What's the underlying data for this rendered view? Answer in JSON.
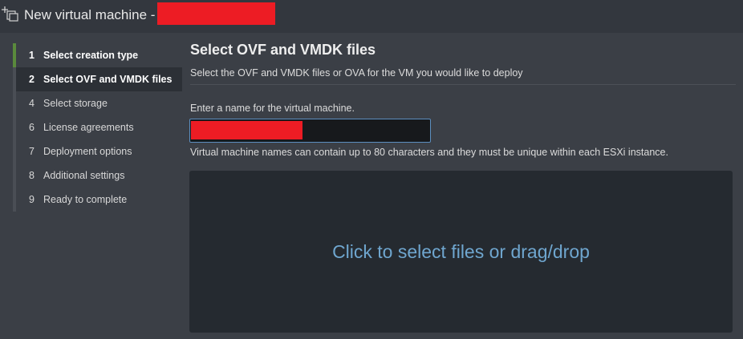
{
  "window": {
    "title": "New virtual machine -",
    "icon": "deploy-vm-icon"
  },
  "steps": [
    {
      "num": "1",
      "label": "Select creation type",
      "state": "completed"
    },
    {
      "num": "2",
      "label": "Select OVF and VMDK files",
      "state": "active"
    },
    {
      "num": "4",
      "label": "Select storage",
      "state": "pending"
    },
    {
      "num": "6",
      "label": "License agreements",
      "state": "pending"
    },
    {
      "num": "7",
      "label": "Deployment options",
      "state": "pending"
    },
    {
      "num": "8",
      "label": "Additional settings",
      "state": "pending"
    },
    {
      "num": "9",
      "label": "Ready to complete",
      "state": "pending"
    }
  ],
  "main": {
    "title": "Select OVF and VMDK files",
    "subtitle": "Select the OVF and VMDK files or OVA for the VM you would like to deploy",
    "name_label": "Enter a name for the virtual machine.",
    "name_value": "",
    "name_hint": "Virtual machine names can contain up to 80 characters and they must be unique within each ESXi instance.",
    "dropzone_text": "Click to select files or drag/drop"
  },
  "colors": {
    "accent": "#6fa6cf",
    "completed": "#5a8a3c",
    "redaction": "#ed1c24"
  }
}
